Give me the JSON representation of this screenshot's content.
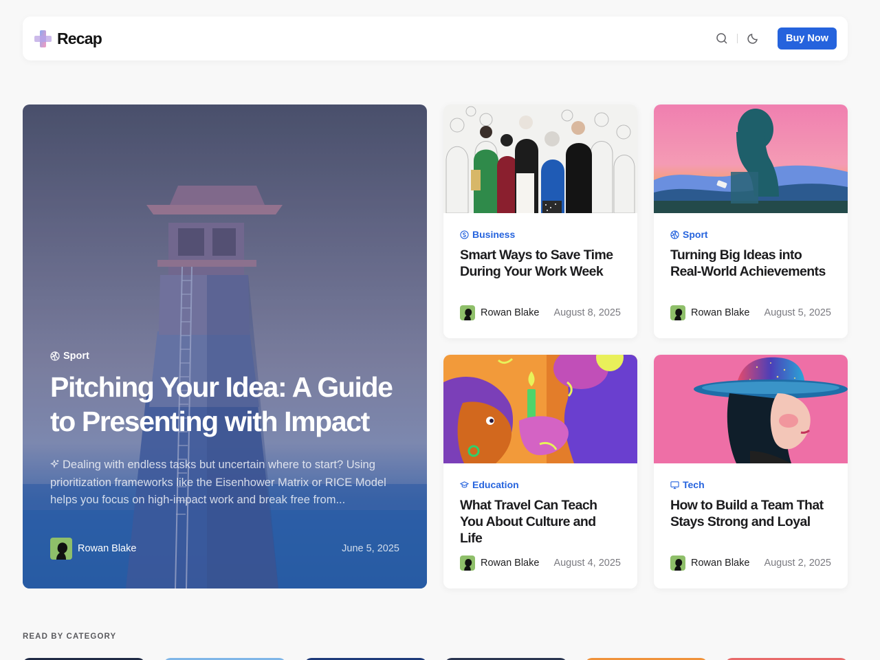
{
  "header": {
    "logo_text": "Recap",
    "buy_label": "Buy Now",
    "icons": [
      "search-icon",
      "moon-icon"
    ]
  },
  "colors": {
    "accent": "#2563dd",
    "background": "#f8f8f8",
    "card": "#ffffff"
  },
  "hero": {
    "category": "Sport",
    "category_icon": "basketball-icon",
    "title": "Pitching Your Idea: A Guide to Presenting with Impact",
    "excerpt": "Dealing with endless tasks but uncertain where to start? Using prioritization frameworks like the Eisenhower Matrix or RICE Model helps you focus on high-impact work and break free from...",
    "author": "Rowan Blake",
    "date": "June 5, 2025"
  },
  "posts": [
    {
      "category": "Business",
      "category_icon": "dollar-circle-icon",
      "title": "Smart Ways to Save Time During Your Work Week",
      "author": "Rowan Blake",
      "date": "August 8, 2025"
    },
    {
      "category": "Sport",
      "category_icon": "basketball-icon",
      "title": "Turning Big Ideas into Real-World Achievements",
      "author": "Rowan Blake",
      "date": "August 5, 2025"
    },
    {
      "category": "Education",
      "category_icon": "graduation-cap-icon",
      "title": "What Travel Can Teach You About Culture and Life",
      "author": "Rowan Blake",
      "date": "August 4, 2025"
    },
    {
      "category": "Tech",
      "category_icon": "monitor-icon",
      "title": "How to Build a Team That Stays Strong and Loyal",
      "author": "Rowan Blake",
      "date": "August 2, 2025"
    }
  ],
  "categories_section": {
    "label": "READ BY CATEGORY"
  }
}
